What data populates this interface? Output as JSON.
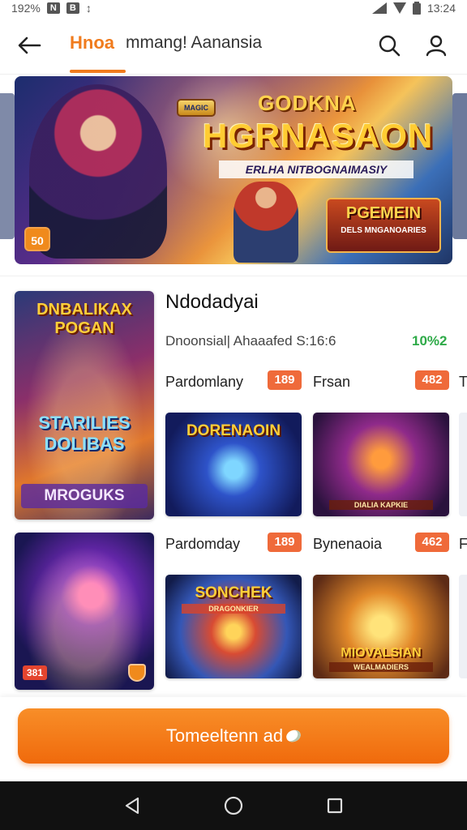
{
  "status_bar": {
    "left_text": "192%",
    "icon_1": "N",
    "icon_2": "B",
    "icon_3": "↕",
    "time": "13:24",
    "icons": [
      "signal-icon",
      "wifi-icon",
      "battery-icon"
    ]
  },
  "app_bar": {
    "active_tab": "Hnoa",
    "inactive_tab": "mmang! Aanansia",
    "icons": [
      "back-arrow-icon",
      "search-icon",
      "profile-icon"
    ],
    "accent_color": "#f07b1d"
  },
  "banner": {
    "badge_top": "MAGIC",
    "title_line_1": "GODKNA",
    "title_line_2": "HGRNASAON",
    "subtitle": "ERLHA NITBOGNAIMASIY",
    "logo_title": "PGEMEIN",
    "logo_subtitle": "DELS MNGANOARIES",
    "age_badge": "50"
  },
  "section": {
    "title": "Ndodadyai",
    "subtitle": "Dnoonsial| Ahaaafed S:16:6",
    "percent": "10%2",
    "percent_color": "#2eaa48"
  },
  "features": [
    {
      "title_top": "DNBALIKAX POGAN",
      "title_mid": "STARILIES DOLIBAS",
      "title_bottom": "MROGUKS"
    },
    {
      "tag": "381"
    }
  ],
  "rows": [
    {
      "items": [
        {
          "label": "Pardomlany",
          "badge": "189"
        },
        {
          "label": "Frsan",
          "badge": "482"
        }
      ],
      "overflow_label": "T",
      "thumbs": [
        {
          "title": "DORENAOIN",
          "sub": ""
        },
        {
          "title": "",
          "sub": "DIALIA KAPKIE"
        }
      ]
    },
    {
      "items": [
        {
          "label": "Pardomday",
          "badge": "189"
        },
        {
          "label": "Bynenaoia",
          "badge": "462"
        }
      ],
      "overflow_label": "F",
      "thumbs": [
        {
          "title": "SONCHEK",
          "sub": "DRAGONKIER"
        },
        {
          "title": "MIOVALSIAN",
          "sub": "WEALMADIERS"
        }
      ]
    }
  ],
  "cta": {
    "label": "Tomeeltenn ad",
    "color": "#f07b1d"
  },
  "system_nav": {
    "icons": [
      "nav-back-icon",
      "nav-home-icon",
      "nav-recents-icon"
    ]
  }
}
